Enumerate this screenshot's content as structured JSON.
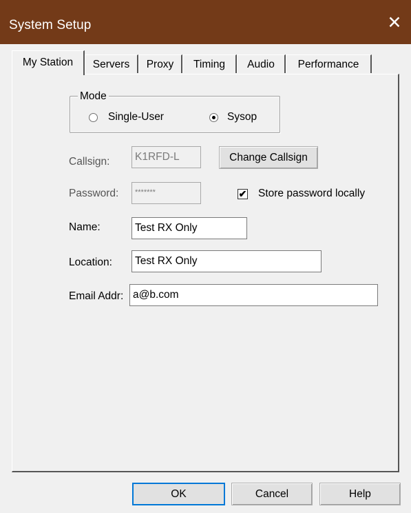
{
  "window": {
    "title": "System Setup",
    "close_glyph": "✕"
  },
  "tabs": [
    {
      "label": "My Station",
      "active": true
    },
    {
      "label": "Servers"
    },
    {
      "label": "Proxy"
    },
    {
      "label": "Timing"
    },
    {
      "label": "Audio"
    },
    {
      "label": "Performance"
    }
  ],
  "mode": {
    "legend": "Mode",
    "options": [
      {
        "label": "Single-User",
        "selected": false
      },
      {
        "label": "Sysop",
        "selected": true
      }
    ]
  },
  "fields": {
    "callsign": {
      "label": "Callsign:",
      "value": "K1RFD-L",
      "enabled": false
    },
    "password": {
      "label": "Password:",
      "value": "*******",
      "enabled": false
    },
    "name": {
      "label": "Name:",
      "value": "Test RX Only"
    },
    "location": {
      "label": "Location:",
      "value": "Test RX Only"
    },
    "email": {
      "label": "Email Addr:",
      "value": "a@b.com"
    }
  },
  "change_callsign_label": "Change Callsign",
  "store_password": {
    "label": "Store password locally",
    "checked": true,
    "check_glyph": "✔"
  },
  "footer": {
    "ok_label": "OK",
    "cancel_label": "Cancel",
    "help_label": "Help"
  },
  "colors": {
    "titlebar": "#733a18",
    "dialog_bg": "#f0f0f0"
  }
}
